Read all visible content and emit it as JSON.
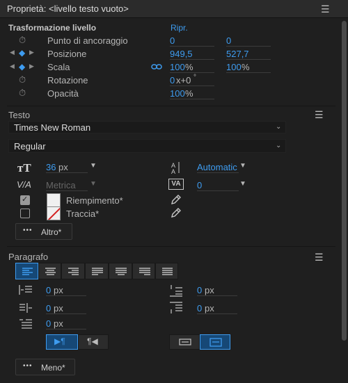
{
  "panel": {
    "title": "Proprietà: <livello testo vuoto>"
  },
  "transform": {
    "heading": "Trasformazione livello",
    "reset": "Ripr.",
    "rows": [
      {
        "label": "Punto di ancoraggio",
        "x": "0",
        "y": "0"
      },
      {
        "label": "Posizione",
        "x": "949,5",
        "y": "527,7"
      },
      {
        "label": "Scala",
        "x": "100",
        "y": "100",
        "unit": "%"
      },
      {
        "label": "Rotazione",
        "x": "0",
        "x_suffix": "x+0",
        "unit": "°"
      },
      {
        "label": "Opacità",
        "x": "100",
        "unit": "%"
      }
    ]
  },
  "text": {
    "heading": "Testo",
    "font": "Times New Roman",
    "style": "Regular",
    "size": "36",
    "size_unit": "px",
    "leading": "Automatic",
    "kerning": "Metrica",
    "tracking": "0",
    "fill_label": "Riempimento*",
    "stroke_label": "Traccia*",
    "more_label": "Altro*",
    "more_dots": "•••"
  },
  "paragraph": {
    "heading": "Paragrafo",
    "indent_left": "0",
    "indent_first": "0",
    "indent_right": "0",
    "space_before": "0",
    "space_after": "0",
    "unit": "px",
    "less_label": "Meno*",
    "less_dots": "•••"
  },
  "colors": {
    "accent": "#3e9cf0",
    "background": "#1f1f1f"
  }
}
